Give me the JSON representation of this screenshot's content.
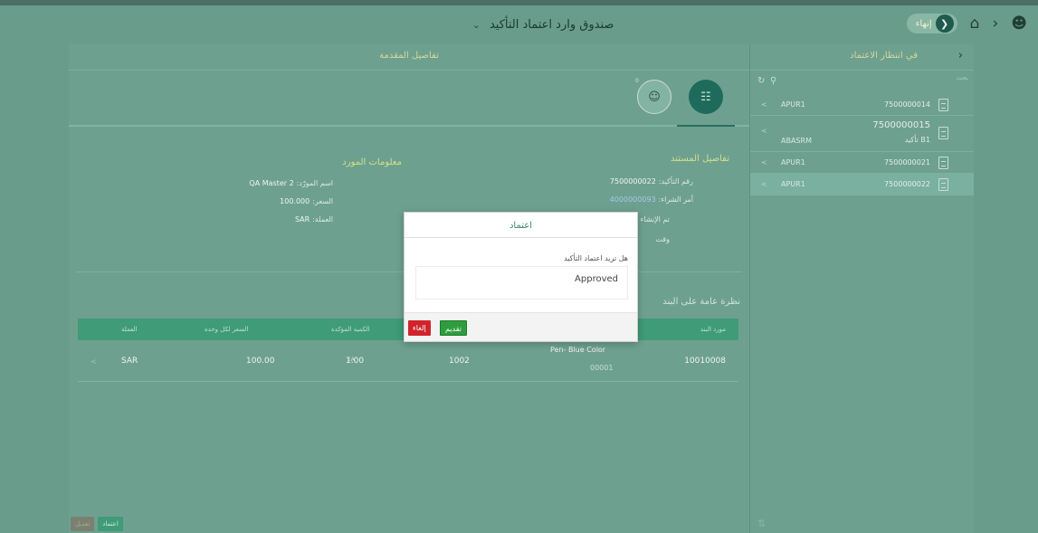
{
  "shell": {
    "title": "صندوق وارد اعتماد التأكيد",
    "home_label": "إنهاء"
  },
  "master": {
    "title": "في انتظار الاعتماد",
    "search_label": "بحث",
    "items": [
      {
        "vendor": "APUR1",
        "number": "7500000014"
      },
      {
        "vendor": "ABASRM",
        "number": "7500000015",
        "sub": "تأكيد B1"
      },
      {
        "vendor": "APUR1",
        "number": "7500000021"
      },
      {
        "vendor": "APUR1",
        "number": "7500000022"
      }
    ]
  },
  "detail": {
    "header": "تفاصيل المقدمة",
    "tab_badge": "0",
    "doc_section": {
      "title": "تفاصيل المستند",
      "fields": [
        {
          "label": "رقم التأكيد:",
          "value": "7500000022"
        },
        {
          "label": "أمر الشراء:",
          "value": "4000000093"
        },
        {
          "label": "تم الإنشاء",
          "value": ""
        },
        {
          "label": "وقت",
          "value": ""
        }
      ]
    },
    "vendor_section": {
      "title": "معلومات المورد",
      "fields": [
        {
          "label": "اسم المورّد:",
          "value": "QA Master 2"
        },
        {
          "label": "السعر:",
          "value": "100.000"
        },
        {
          "label": "العملة:",
          "value": "SAR"
        }
      ]
    },
    "items_title": "نظرة عامة على البند",
    "table": {
      "columns": [
        "مورد البند",
        "",
        "الكمية المؤكدة",
        "السعر لكل وحدة",
        "العملة"
      ],
      "rows": [
        {
          "vendor_item": "10010008",
          "material": "Pen- Blue Color",
          "material_sub": "00001",
          "plant": "1002",
          "qty": "1.00",
          "qty_unit": "EA",
          "price": "100.00",
          "currency": "SAR"
        }
      ]
    },
    "footer": {
      "gray_label": "تعديل",
      "green_label": "اعتماد"
    }
  },
  "dialog": {
    "title": "اعتماد",
    "question": "هل تريد اعتماد التأكيد",
    "text": "Approved",
    "submit_label": "تقديم",
    "cancel_label": "إلغاء"
  },
  "colors": {
    "overlay": "#6a9c8b",
    "accent": "#1e6b5b",
    "submit": "#2e9d3e",
    "cancel": "#d0242a"
  }
}
